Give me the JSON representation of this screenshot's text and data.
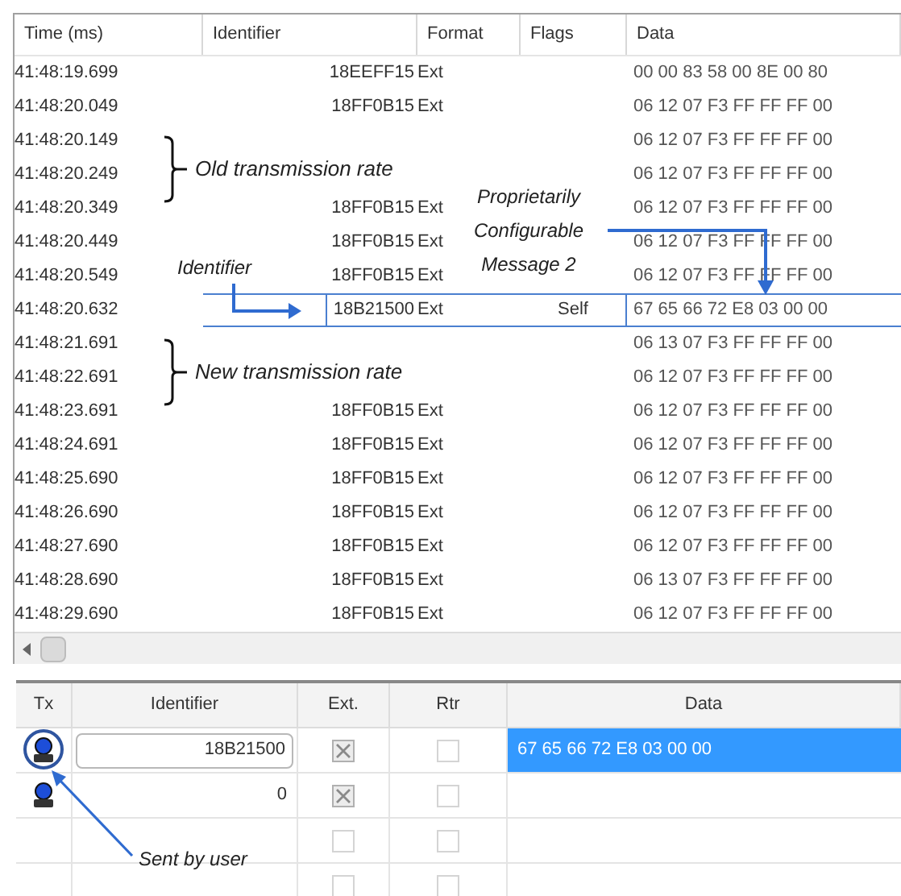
{
  "log_table": {
    "columns": [
      "Time (ms)",
      "Identifier",
      "Format",
      "Flags",
      "Data"
    ],
    "rows": [
      {
        "time": "41:48:19.699",
        "identifier": "18EEFF15",
        "format": "Ext",
        "data": "00 00 83 58 00 8E 00 80",
        "highlighted": false
      },
      {
        "time": "41:48:20.049",
        "identifier": "18FF0B15",
        "format": "Ext",
        "data": "06 12 07 F3 FF FF FF 00",
        "highlighted": false
      },
      {
        "time": "41:48:20.149",
        "data": "06 12 07 F3 FF FF FF 00",
        "highlighted": false
      },
      {
        "time": "41:48:20.249",
        "data": "06 12 07 F3 FF FF FF 00",
        "highlighted": false
      },
      {
        "time": "41:48:20.349",
        "identifier": "18FF0B15",
        "format": "Ext",
        "data": "06 12 07 F3 FF FF FF 00",
        "highlighted": false
      },
      {
        "time": "41:48:20.449",
        "identifier": "18FF0B15",
        "format": "Ext",
        "data": "06 12 07 F3 FF FF FF 00",
        "highlighted": false
      },
      {
        "time": "41:48:20.549",
        "identifier": "18FF0B15",
        "format": "Ext",
        "data": "06 12 07 F3 FF FF FF 00",
        "highlighted": false
      },
      {
        "time": "41:48:20.632",
        "identifier": "18B21500",
        "format": "Ext",
        "flags": "Self",
        "data": "67 65 66 72 E8 03 00 00",
        "highlighted": true
      },
      {
        "time": "41:48:21.691",
        "data": "06 13 07 F3 FF FF FF 00",
        "highlighted": false
      },
      {
        "time": "41:48:22.691",
        "data": "06 12 07 F3 FF FF FF 00",
        "highlighted": false
      },
      {
        "time": "41:48:23.691",
        "identifier": "18FF0B15",
        "format": "Ext",
        "data": "06 12 07 F3 FF FF FF 00",
        "highlighted": false
      },
      {
        "time": "41:48:24.691",
        "identifier": "18FF0B15",
        "format": "Ext",
        "data": "06 12 07 F3 FF FF FF 00",
        "highlighted": false
      },
      {
        "time": "41:48:25.690",
        "identifier": "18FF0B15",
        "format": "Ext",
        "data": "06 12 07 F3 FF FF FF 00",
        "highlighted": false
      },
      {
        "time": "41:48:26.690",
        "identifier": "18FF0B15",
        "format": "Ext",
        "data": "06 12 07 F3 FF FF FF 00",
        "highlighted": false
      },
      {
        "time": "41:48:27.690",
        "identifier": "18FF0B15",
        "format": "Ext",
        "data": "06 12 07 F3 FF FF FF 00",
        "highlighted": false
      },
      {
        "time": "41:48:28.690",
        "identifier": "18FF0B15",
        "format": "Ext",
        "data": "06 13 07 F3 FF FF FF 00",
        "highlighted": false
      },
      {
        "time": "41:48:29.690",
        "identifier": "18FF0B15",
        "format": "Ext",
        "data": "06 12 07 F3 FF FF FF 00",
        "highlighted": false
      }
    ]
  },
  "annotations": [
    {
      "kind": "bracket",
      "text": "Old transmission rate"
    },
    {
      "kind": "identifier_arrow",
      "text": "Identifier"
    },
    {
      "kind": "data_arrow",
      "text": "Proprietarily Configurable Message 2"
    },
    {
      "kind": "bracket",
      "text": "New transmission rate"
    },
    {
      "kind": "sent_arrow",
      "text": "Sent by user"
    }
  ],
  "transmit_table": {
    "columns": [
      "Tx",
      "Identifier",
      "Ext.",
      "Rtr",
      "Data"
    ],
    "rows": [
      {
        "tx_icon": true,
        "identifier": "18B21500",
        "ext": true,
        "rtr": false,
        "data": "67 65 66 72 E8 03 00 00",
        "selected": true
      },
      {
        "tx_icon": true,
        "identifier": "0",
        "ext": true,
        "rtr": false,
        "selected": false
      },
      {
        "tx_icon": false,
        "ext": false,
        "rtr": false,
        "selected": false
      },
      {
        "tx_icon": false,
        "ext": false,
        "rtr": false,
        "selected": false
      }
    ]
  }
}
